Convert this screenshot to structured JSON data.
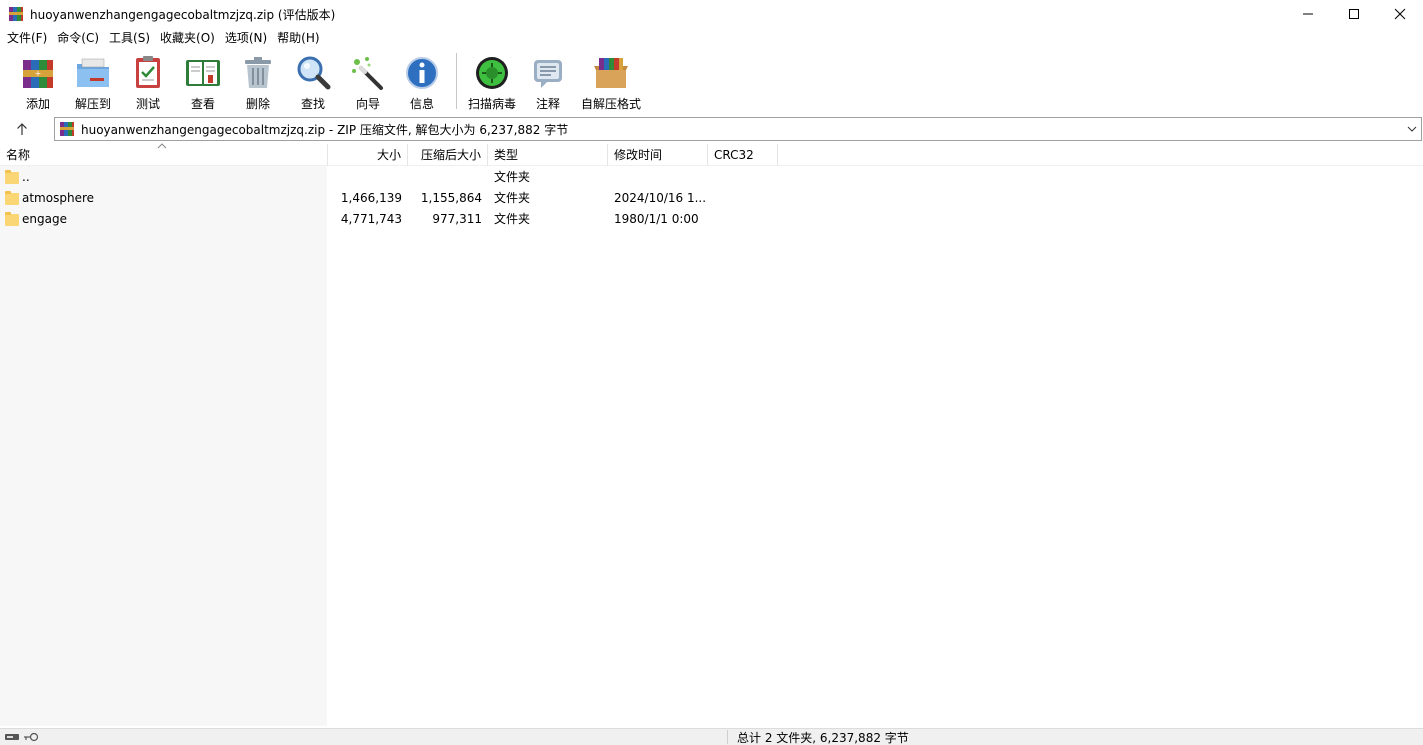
{
  "window": {
    "title": "huoyanwenzhangengagecobaltmzjzq.zip (评估版本)",
    "controls": [
      "minimize",
      "maximize",
      "close"
    ]
  },
  "menu": [
    "文件(F)",
    "命令(C)",
    "工具(S)",
    "收藏夹(O)",
    "选项(N)",
    "帮助(H)"
  ],
  "toolbar": {
    "buttons": [
      {
        "label": "添加",
        "icon": "add-archive-icon"
      },
      {
        "label": "解压到",
        "icon": "extract-folder-icon"
      },
      {
        "label": "测试",
        "icon": "test-clipboard-icon"
      },
      {
        "label": "查看",
        "icon": "view-book-icon"
      },
      {
        "label": "删除",
        "icon": "trash-icon"
      },
      {
        "label": "查找",
        "icon": "magnifier-icon"
      },
      {
        "label": "向导",
        "icon": "wizard-wand-icon"
      },
      {
        "label": "信息",
        "icon": "info-icon"
      },
      {
        "label": "扫描病毒",
        "icon": "virus-scan-icon"
      },
      {
        "label": "注释",
        "icon": "comment-icon"
      },
      {
        "label": "自解压格式",
        "icon": "sfx-box-icon"
      }
    ]
  },
  "address": {
    "text": "huoyanwenzhangengagecobaltmzjzq.zip - ZIP 压缩文件, 解包大小为 6,237,882 字节"
  },
  "columns": {
    "name": "名称",
    "size": "大小",
    "packed": "压缩后大小",
    "type": "类型",
    "modified": "修改时间",
    "crc": "CRC32"
  },
  "files": [
    {
      "name": "..",
      "size": "",
      "packed": "",
      "type": "文件夹",
      "modified": "",
      "crc": ""
    },
    {
      "name": "atmosphere",
      "size": "1,466,139",
      "packed": "1,155,864",
      "type": "文件夹",
      "modified": "2024/10/16 1...",
      "crc": ""
    },
    {
      "name": "engage",
      "size": "4,771,743",
      "packed": "977,311",
      "type": "文件夹",
      "modified": "1980/1/1 0:00",
      "crc": ""
    }
  ],
  "status": {
    "summary": "总计 2 文件夹, 6,237,882 字节"
  },
  "colors": {
    "folder": "#fbd674",
    "left_pane_bg": "#f7f7f7",
    "statusbar_bg": "#f0f0f0"
  }
}
